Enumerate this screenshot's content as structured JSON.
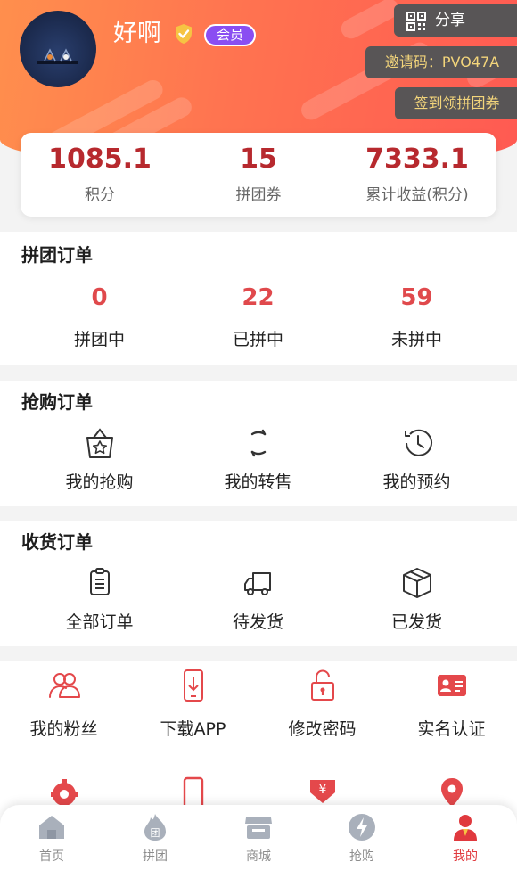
{
  "profile": {
    "name": "好啊",
    "member_badge": "会员"
  },
  "header": {
    "share_label": "分享",
    "invite_label": "邀请码：PVO47A",
    "checkin_label": "签到领拼团券"
  },
  "stats": [
    {
      "value": "1085.1",
      "label": "积分"
    },
    {
      "value": "15",
      "label": "拼团券"
    },
    {
      "value": "7333.1",
      "label": "累计收益(积分)"
    }
  ],
  "group_orders": {
    "title": "拼团订单",
    "items": [
      {
        "count": "0",
        "label": "拼团中"
      },
      {
        "count": "22",
        "label": "已拼中"
      },
      {
        "count": "59",
        "label": "未拼中"
      }
    ]
  },
  "flash_orders": {
    "title": "抢购订单",
    "items": [
      {
        "label": "我的抢购",
        "icon": "shopping-bag-star-icon"
      },
      {
        "label": "我的转售",
        "icon": "refresh-icon"
      },
      {
        "label": "我的预约",
        "icon": "history-clock-icon"
      }
    ]
  },
  "receipt_orders": {
    "title": "收货订单",
    "items": [
      {
        "label": "全部订单",
        "icon": "clipboard-icon"
      },
      {
        "label": "待发货",
        "icon": "truck-icon"
      },
      {
        "label": "已发货",
        "icon": "package-icon"
      }
    ]
  },
  "tools": [
    {
      "label": "我的粉丝",
      "icon": "fans-icon"
    },
    {
      "label": "下载APP",
      "icon": "download-phone-icon"
    },
    {
      "label": "修改密码",
      "icon": "unlock-icon"
    },
    {
      "label": "实名认证",
      "icon": "id-card-icon"
    }
  ],
  "tools_row2": [
    {
      "icon": "settings-gear-icon"
    },
    {
      "icon": "phone-icon"
    },
    {
      "icon": "yuan-icon"
    },
    {
      "icon": "location-icon"
    }
  ],
  "tabbar": [
    {
      "label": "首页",
      "icon": "home-icon"
    },
    {
      "label": "拼团",
      "icon": "group-flame-icon"
    },
    {
      "label": "商城",
      "icon": "store-icon"
    },
    {
      "label": "抢购",
      "icon": "lightning-icon"
    },
    {
      "label": "我的",
      "icon": "user-icon",
      "active": true
    }
  ],
  "colors": {
    "header_start": "#ff8f4d",
    "header_end": "#ff5a52",
    "stat_value": "#b7292e",
    "accent_red": "#e0494c",
    "member_purple": "#8a4ef2",
    "dark_button": "#585556",
    "gold_text": "#f3d57b"
  }
}
